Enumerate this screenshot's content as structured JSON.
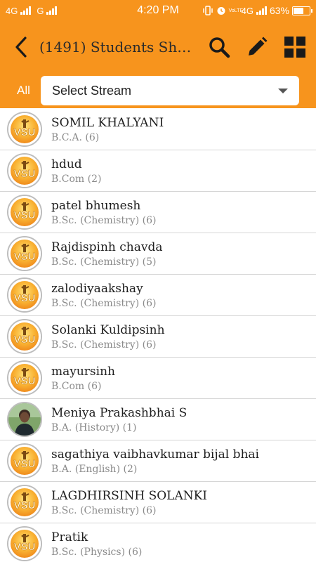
{
  "status_bar": {
    "network_left_1": "4G",
    "network_left_2": "G",
    "time": "4:20 PM",
    "network_right": "4G",
    "volte": "VoLTE",
    "battery": "63%"
  },
  "header": {
    "back_icon": "chevron-left-icon",
    "title": "(1491) Students  Shri...",
    "actions": [
      "search-icon",
      "pencil-icon",
      "grid-icon"
    ]
  },
  "filter": {
    "all_label": "All",
    "stream_select_value": "Select Stream"
  },
  "colors": {
    "accent": "#f7941d",
    "text_primary": "#1e1e1e",
    "text_secondary": "#8a8a8a"
  },
  "students": [
    {
      "name": "SOMIL KHALYANI",
      "course": "B.C.A. (6)",
      "avatar": "vsu-logo"
    },
    {
      "name": "hdud",
      "course": "B.Com (2)",
      "avatar": "vsu-logo"
    },
    {
      "name": "patel bhumesh",
      "course": "B.Sc. (Chemistry) (6)",
      "avatar": "vsu-logo"
    },
    {
      "name": "Rajdispinh chavda",
      "course": "B.Sc. (Chemistry) (5)",
      "avatar": "vsu-logo"
    },
    {
      "name": "zalodiyaakshay",
      "course": "B.Sc. (Chemistry) (6)",
      "avatar": "vsu-logo"
    },
    {
      "name": "Solanki Kuldipsinh",
      "course": "B.Sc. (Chemistry) (6)",
      "avatar": "vsu-logo"
    },
    {
      "name": "mayursinh",
      "course": "B.Com (6)",
      "avatar": "vsu-logo"
    },
    {
      "name": "Meniya Prakashbhai S",
      "course": "B.A. (History) (1)",
      "avatar": "photo"
    },
    {
      "name": "sagathiya vaibhavkumar bijal bhai",
      "course": "B.A. (English) (2)",
      "avatar": "vsu-logo"
    },
    {
      "name": "LAGDHIRSINH SOLANKI",
      "course": "B.Sc. (Chemistry) (6)",
      "avatar": "vsu-logo"
    },
    {
      "name": "Pratik",
      "course": "B.Sc. (Physics) (6)",
      "avatar": "vsu-logo"
    }
  ]
}
